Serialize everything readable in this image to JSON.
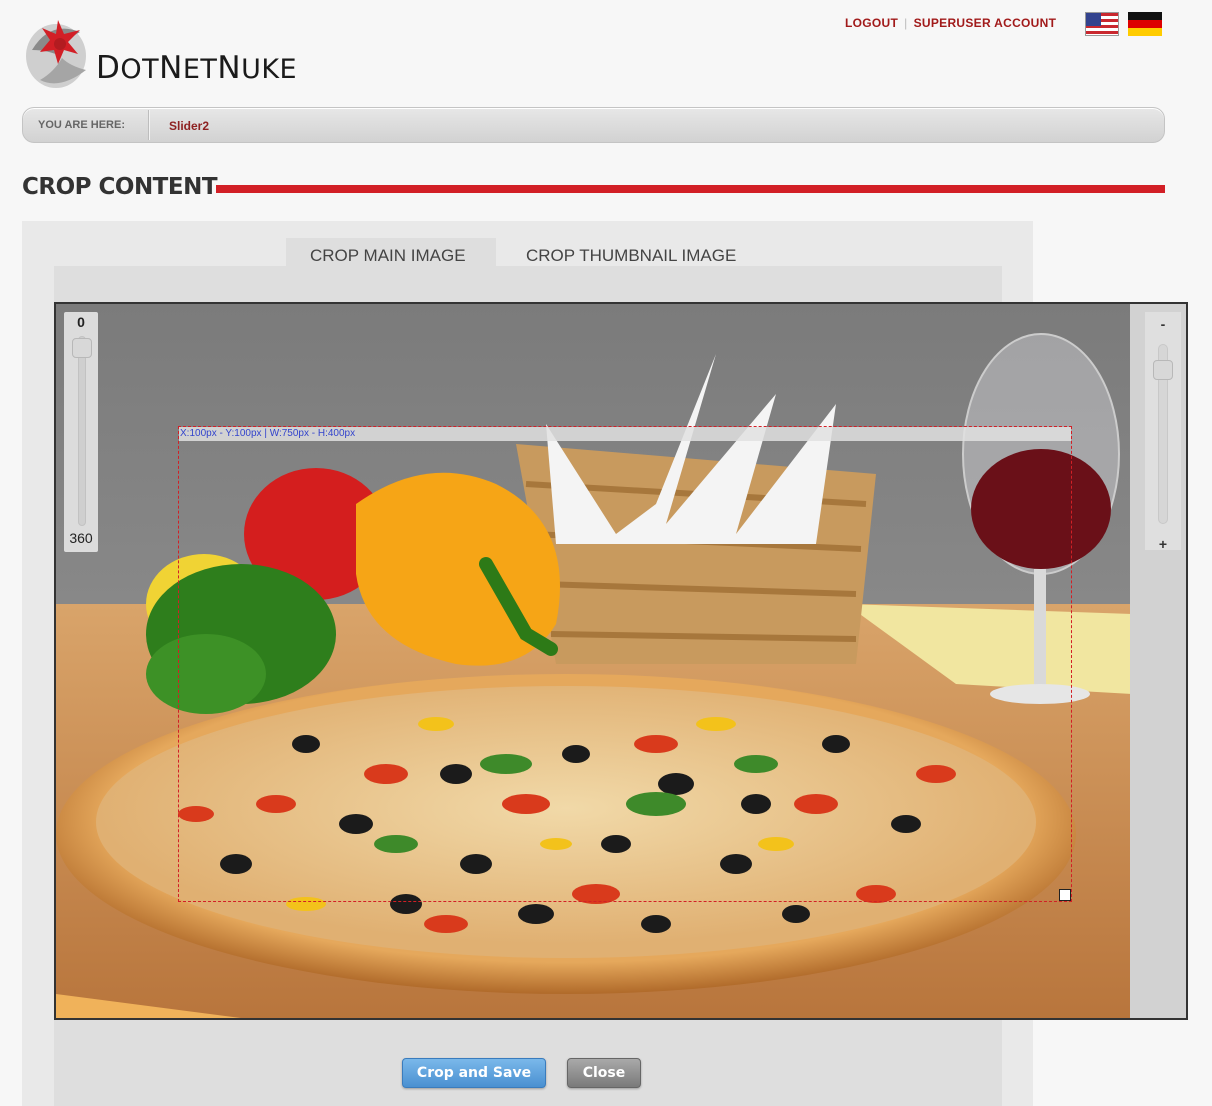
{
  "brand": {
    "name_first": "D",
    "name_rest": "OT",
    "name_n": "N",
    "name_et": "ET",
    "name_nu": "N",
    "name_uke": "UKE"
  },
  "header": {
    "logout": "LOGOUT",
    "account": "SUPERUSER ACCOUNT",
    "flags": [
      "en-US",
      "de-DE"
    ]
  },
  "breadcrumb": {
    "label": "YOU ARE HERE:",
    "current": "Slider2"
  },
  "page": {
    "title": "CROP CONTENT"
  },
  "tabs": [
    {
      "label": "CROP MAIN IMAGE",
      "active": true
    },
    {
      "label": "CROP THUMBNAIL IMAGE",
      "active": false
    }
  ],
  "rotation": {
    "min": "0",
    "max": "360",
    "value": 0
  },
  "zoom": {
    "minus": "-",
    "plus": "+"
  },
  "crop": {
    "info": "X:100px - Y:100px | W:750px - H:400px"
  },
  "buttons": {
    "save": "Crop and Save",
    "close": "Close"
  },
  "colors": {
    "accent": "#d21f26",
    "link": "#a11a1a",
    "save_button": "#4a90d1"
  }
}
